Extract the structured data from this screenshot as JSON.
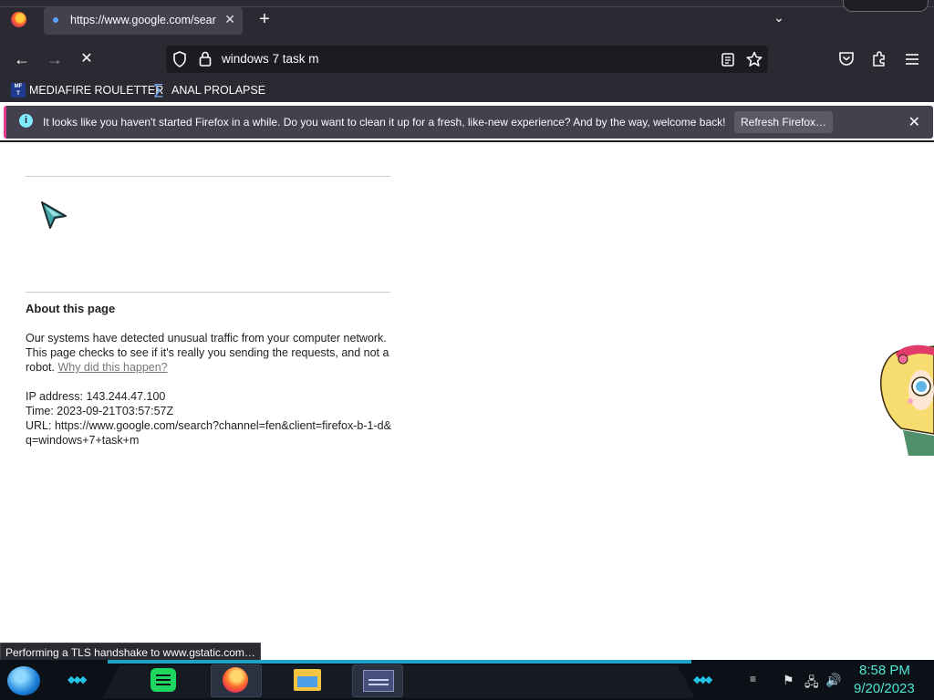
{
  "tab": {
    "title": "https://www.google.com/search",
    "close": "✕"
  },
  "toolbar": {
    "new_tab": "+",
    "list_tabs": "⌄",
    "back": "←",
    "forward": "→",
    "stop": "✕"
  },
  "urlbar": {
    "value": "windows 7 task m"
  },
  "bookmarks": [
    {
      "label": "MEDIAFIRE ROULETTER",
      "icon": "mediafire-icon"
    },
    {
      "label": "ANAL PROLAPSE",
      "icon": "sigma-icon"
    }
  ],
  "notification": {
    "text": "It looks like you haven't started Firefox in a while. Do you want to clean it up for a fresh, like-new experience? And by the way, welcome back!",
    "button": "Refresh Firefox…",
    "close": "✕"
  },
  "page": {
    "about_title": "About this page",
    "about_text": "Our systems have detected unusual traffic from your computer network. This page checks to see if it's really you sending the requests, and not a robot. ",
    "why_link": "Why did this happen?",
    "ip": "IP address: 143.244.47.100",
    "time": "Time: 2023-09-21T03:57:57Z",
    "url": "URL: https://www.google.com/search?channel=fen&client=firefox-b-1-d&q=windows+7+task+m"
  },
  "status": {
    "text": "Performing a TLS handshake to www.gstatic.com…"
  },
  "taskbar": {
    "time": "8:58 PM",
    "date": "9/20/2023",
    "apps": [
      "spotify-icon",
      "firefox-icon",
      "file-explorer-icon",
      "window-icon"
    ]
  },
  "colors": {
    "chrome": "#2b2a33",
    "urlbar": "#1c1b22",
    "accent": "#e6398b",
    "clock": "#4ee6d2"
  }
}
